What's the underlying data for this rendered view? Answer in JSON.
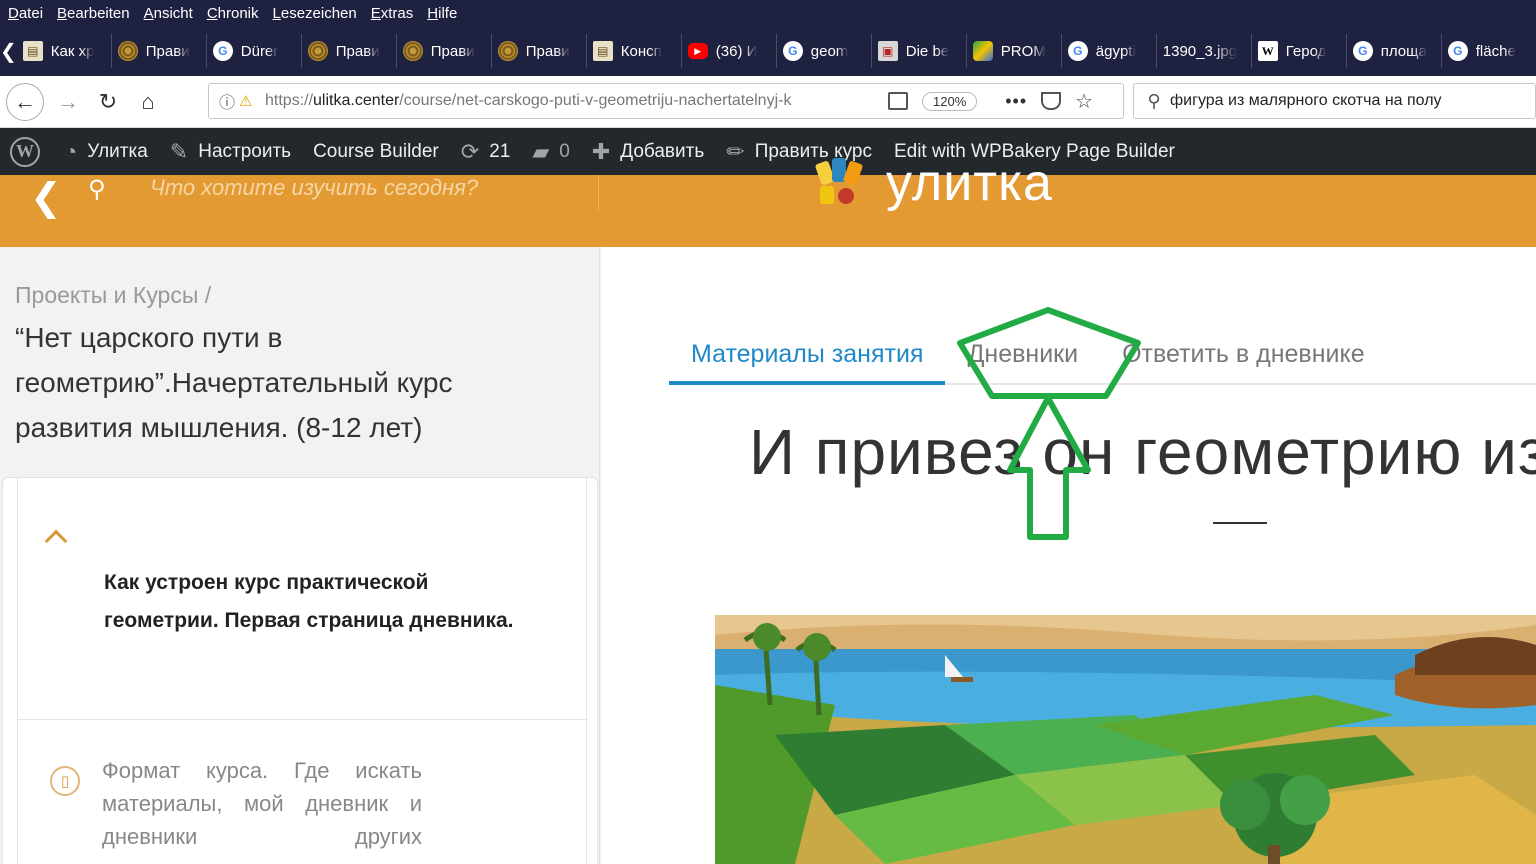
{
  "menu": [
    "Datei",
    "Bearbeiten",
    "Ansicht",
    "Chronik",
    "Lesezeichen",
    "Extras",
    "Hilfe"
  ],
  "menu_access": [
    "D",
    "B",
    "A",
    "C",
    "L",
    "E",
    "H"
  ],
  "tabs": [
    {
      "label": "Как хр",
      "icon": "book-icon"
    },
    {
      "label": "Прави",
      "icon": "spiral-icon"
    },
    {
      "label": "Dürer",
      "icon": "google-icon"
    },
    {
      "label": "Прави",
      "icon": "spiral-icon"
    },
    {
      "label": "Прави",
      "icon": "spiral-icon"
    },
    {
      "label": "Прави",
      "icon": "spiral-icon"
    },
    {
      "label": "Консп",
      "icon": "book-icon"
    },
    {
      "label": "(36) И",
      "icon": "youtube-icon"
    },
    {
      "label": "geom",
      "icon": "google-icon"
    },
    {
      "label": "Die be",
      "icon": "document-icon"
    },
    {
      "label": "PROM",
      "icon": "gem-icon"
    },
    {
      "label": "ägypti",
      "icon": "google-icon"
    },
    {
      "label": "1390_3.jpg",
      "icon": "none"
    },
    {
      "label": "Герод",
      "icon": "wikipedia-icon"
    },
    {
      "label": "площа",
      "icon": "google-icon"
    },
    {
      "label": "fläche",
      "icon": "google-icon"
    }
  ],
  "nav": {
    "url_scheme": "https://",
    "url_host": "ulitka.center",
    "url_path": "/course/net-carskogo-puti-v-geometriju-nachertatelnyj-k",
    "zoom": "120%",
    "search_value": "фигура из малярного скотча на полу"
  },
  "wpbar": {
    "site": "Улитка",
    "customize": "Настроить",
    "course_builder": "Course Builder",
    "updates": "21",
    "comments": "0",
    "add": "Добавить",
    "edit_course": "Править курс",
    "wpbakery": "Edit with WPBakery Page Builder"
  },
  "header": {
    "search_placeholder": "Что хотите изучить сегодня?",
    "logo_text": "улитка"
  },
  "sidebar": {
    "breadcrumb": "Проекты и Курсы /",
    "course_title": "“Нет царского пути в геометрию”.Начертательный курс развития мышления. (8-12 лет)",
    "active_lesson": "Как устроен курс практической геометрии. Первая страница дневника.",
    "next_lesson": "Формат курса. Где искать материалы, мой дневник и дневники других"
  },
  "main": {
    "tabs": [
      "Материалы занятия",
      "Дневники",
      "Ответить в дневнике"
    ],
    "heading": "И привез он геометрию из Е"
  },
  "colors": {
    "browser_chrome": "#1f2140",
    "wp_admin_bar": "#23282d",
    "site_accent": "#e39a33",
    "tab_active": "#1e88c8",
    "annotation": "#22aa44"
  }
}
